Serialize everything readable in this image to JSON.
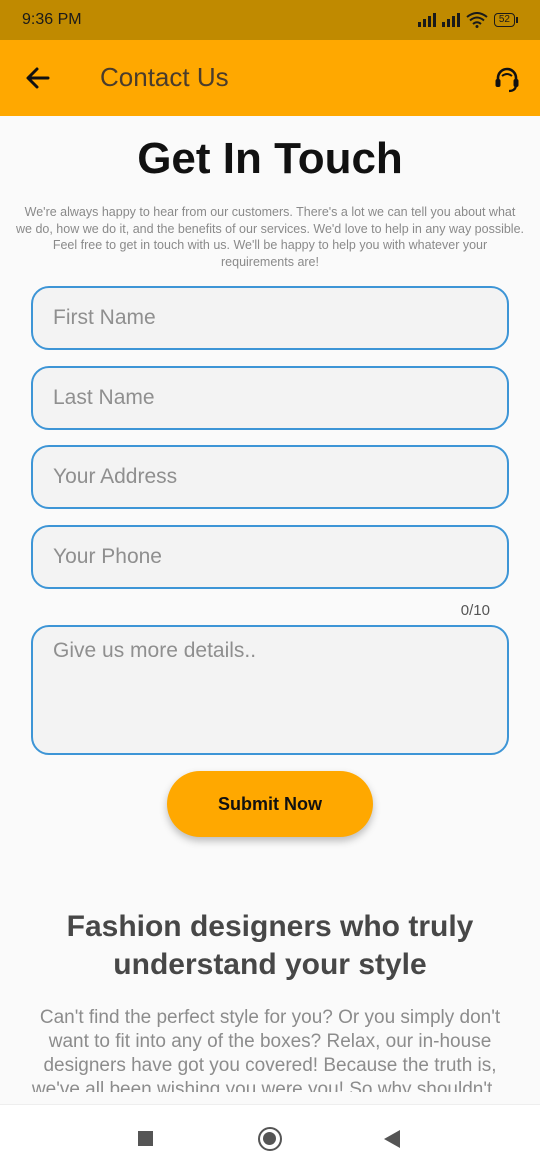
{
  "status_bar": {
    "time": "9:36 PM",
    "battery": "52"
  },
  "app_bar": {
    "title": "Contact Us"
  },
  "main": {
    "heading": "Get In Touch",
    "intro": "We're always happy to hear from our customers. There's a lot we can tell you about what we do, how we do it, and the benefits of our  services. We'd love to help in any way possible. Feel free to get in touch with us. We'll be happy to help you with whatever your requirements are!"
  },
  "form": {
    "first_name": {
      "placeholder": "First Name",
      "value": ""
    },
    "last_name": {
      "placeholder": "Last Name",
      "value": ""
    },
    "address": {
      "placeholder": "Your Address",
      "value": ""
    },
    "phone": {
      "placeholder": "Your Phone",
      "value": "",
      "counter": "0/10"
    },
    "details": {
      "placeholder": "Give us more details..",
      "value": ""
    },
    "submit_label": "Submit Now"
  },
  "section": {
    "title": "Fashion designers who truly understand your style",
    "body": "Can't find the perfect style for you? Or you simply don't want to fit into any of the boxes? Relax, our in-house designers have got you covered! Because the truth is, we've all been wishing you were you! So why shouldn't..."
  },
  "colors": {
    "accent": "#ffa800",
    "status_bar": "#c08a00",
    "field_border": "#3d95d6"
  },
  "icons": {
    "back": "arrow-left-icon",
    "support": "headset-icon",
    "nav_recents": "square-icon",
    "nav_home": "circle-icon",
    "nav_back": "triangle-back-icon"
  }
}
